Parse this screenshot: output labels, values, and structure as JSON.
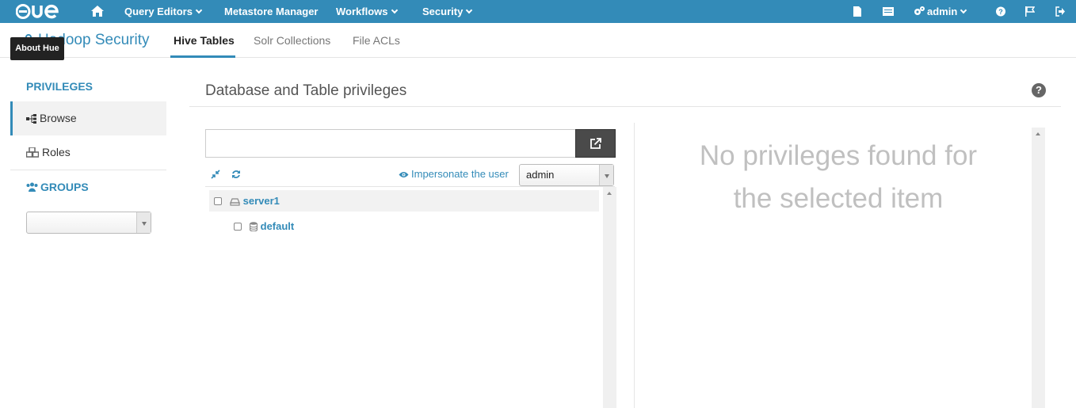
{
  "navbar": {
    "items": [
      {
        "label": "Query Editors",
        "dropdown": true
      },
      {
        "label": "Metastore Manager",
        "dropdown": false
      },
      {
        "label": "Workflows",
        "dropdown": true
      },
      {
        "label": "Security",
        "dropdown": true
      }
    ],
    "user": "admin",
    "icons": [
      "home-icon",
      "document-icon",
      "list-icon",
      "gears-icon",
      "help-icon",
      "flag-icon",
      "logout-icon"
    ],
    "accent_color": "#338bb8"
  },
  "header": {
    "title": "Hadoop Security",
    "tabs": [
      "Hive Tables",
      "Solr Collections",
      "File ACLs"
    ],
    "active_tab": "Hive Tables",
    "tooltip": "About Hue"
  },
  "sidebar": {
    "privileges_heading": "PRIVILEGES",
    "items": [
      {
        "label": "Browse",
        "active": true
      },
      {
        "label": "Roles",
        "active": false
      }
    ],
    "groups_heading": "GROUPS",
    "groups_select": ""
  },
  "main": {
    "title": "Database and Table privileges",
    "search": {
      "value": "",
      "placeholder": ""
    },
    "impersonate_label": "Impersonate the user",
    "impersonate_user": "admin",
    "tree": [
      {
        "label": "server1",
        "icon": "server-icon"
      },
      {
        "label": "default",
        "icon": "database-icon"
      }
    ],
    "empty_message_line1": "No privileges found for",
    "empty_message_line2": "the selected item"
  }
}
